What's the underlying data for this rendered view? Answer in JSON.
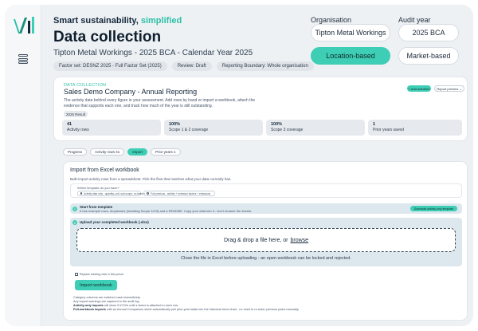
{
  "header": {
    "tagline_main": "Smart sustainability,",
    "tagline_accent": "simplified",
    "title": "Data collection",
    "subtitle": "Tipton Metal Workings - 2025 BCA - Calendar Year 2025",
    "badges": [
      "Factor set: DESNZ 2025 - Full Factor Set (2025)",
      "Review: Draft",
      "Reporting Boundary: Whole organisation"
    ]
  },
  "controls": {
    "org_label": "Organisation",
    "org_value": "Tipton Metal Workings",
    "year_label": "Audit year",
    "year_value": "2025 BCA",
    "location_label": "Location-based",
    "market_label": "Market-based"
  },
  "overview": {
    "eyebrow": "DATA COLLECTION",
    "title": "Sales Demo Company - Annual Reporting",
    "description": "The activity data behind every figure in your assessment. Add rows by hand or import a workbook, attach the evidence that supports each one, and track how much of the year is still outstanding.",
    "year_chip": "2025 Result",
    "add_label": "+ Add activities",
    "report_label": "Report preview ⌄",
    "stats": [
      {
        "value": "41",
        "label": "Activity rows"
      },
      {
        "value": "100%",
        "label": "Scope 1 & 2 coverage"
      },
      {
        "value": "100%",
        "label": "Scope 3 coverage"
      },
      {
        "value": "1",
        "label": "Prior years saved"
      }
    ]
  },
  "tabs": [
    "Progress",
    "Activity rows 41",
    "Import",
    "Prior years 1"
  ],
  "import": {
    "title": "Import from Excel workbook",
    "description": "Bulk-import activity rows from a spreadsheet. Pick the flow that matches what your data currently has.",
    "template_label": "Which template do you have?",
    "option1": "Activity data only - quantity, unit, sub-scope, no factors",
    "option2": "Full previous - activity + emission factors + emissions",
    "step1_title": "Start from template",
    "step1_desc": "It has example rows, dropdowns (including Scope 1/2/3) and a README. Copy your data into it - don't rename the sheets.",
    "download_label": "Download activity-only template",
    "step2_title": "Upload your completed workbook (.xlsx)",
    "drop_text": "Drag & drop a file here, or",
    "drop_link": "browse",
    "drop_note": "Close the file in Excel before uploading - an open workbook can be locked and rejected.",
    "replace_label": "Replace existing rows in this period",
    "import_button": "Import workbook",
    "foot1": "Category columns are matched case-insensitively.",
    "foot2": "Any import warnings are captured in the audit log.",
    "foot3_b": "Activity-only imports",
    "foot3": "will show 0 tCO2e until a factor is attached to each row.",
    "foot4_b": "Full-workbook imports",
    "foot4": "with an Annual Comparison sheet automatically pull prior-year totals into the historical trend chart - no need to re-enter previous years manually."
  }
}
